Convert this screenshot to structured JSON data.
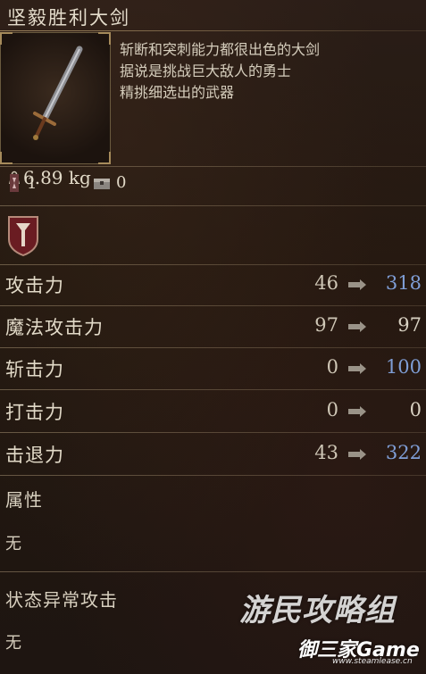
{
  "item": {
    "name": "坚毅胜利大剑",
    "description": [
      "斩断和突刺能力都很出色的大剑",
      "据说是挑战巨大敌人的勇士",
      "精挑细选出的武器"
    ],
    "weight": "6.89 kg",
    "slot_count": "1",
    "storage_count": "0"
  },
  "stats": [
    {
      "label": "攻击力",
      "current": "46",
      "new": "318",
      "new_color": "#7f9ed6"
    },
    {
      "label": "魔法攻击力",
      "current": "97",
      "new": "97",
      "new_color": "#d9d2c3"
    },
    {
      "label": "斩击力",
      "current": "0",
      "new": "100",
      "new_color": "#7f9ed6"
    },
    {
      "label": "打击力",
      "current": "0",
      "new": "0",
      "new_color": "#d9d2c3"
    },
    {
      "label": "击退力",
      "current": "43",
      "new": "322",
      "new_color": "#7f9ed6"
    }
  ],
  "attribute": {
    "label": "属性",
    "value": "无"
  },
  "status_effect": {
    "label": "状态异常攻击",
    "value": "无"
  },
  "watermark": {
    "line1": "游民攻略组",
    "line2": "御三家Game",
    "line3": "www.steamlease.cn"
  },
  "colors": {
    "upgrade": "#7f9ed6",
    "neutral": "#d9d2c3",
    "frame_gold": "#a68b5b"
  },
  "icons": [
    "weight-icon",
    "slot-icon",
    "storage-chest-icon",
    "crest-icon",
    "arrow-icon"
  ]
}
